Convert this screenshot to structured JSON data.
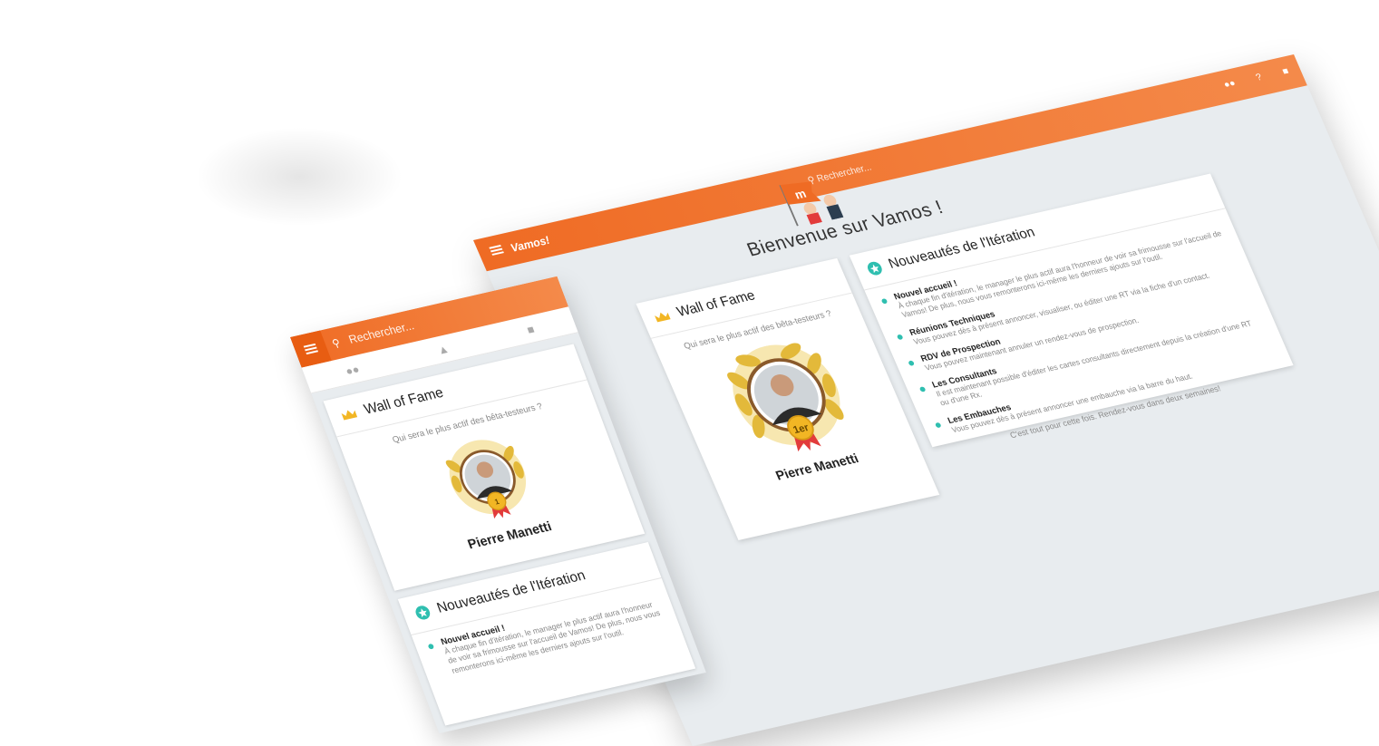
{
  "desktop": {
    "app_name": "Vamos!",
    "search_placeholder": "Rechercher...",
    "icons": [
      "group-icon",
      "help-icon",
      "chat-icon"
    ],
    "welcome_title": "Bienvenue sur Vamos !",
    "wall_of_fame": {
      "title": "Wall of Fame",
      "subtitle": "Qui sera le plus actif des bêta-testeurs ?",
      "rank": "1er",
      "winner": "Pierre Manetti"
    },
    "news": {
      "title": "Nouveautés de l'Itération",
      "items": [
        {
          "heading": "Nouvel accueil !",
          "text": "À chaque fin d'itération, le manager le plus actif aura l'honneur de voir sa frimousse sur l'accueil de Vamos! De plus, nous vous remonterons ici-même les derniers ajouts sur l'outil."
        },
        {
          "heading": "Réunions Techniques",
          "text": "Vous pouvez dès à présent annoncer, visualiser, ou éditer une RT via la fiche d'un contact."
        },
        {
          "heading": "RDV de Prospection",
          "text": "Vous pouvez maintenant annuler un rendez-vous de prospection."
        },
        {
          "heading": "Les Consultants",
          "text": "Il est maintenant possible d'éditer les cartes consultants directement depuis la création d'une RT ou d'une Rx."
        },
        {
          "heading": "Les Embauches",
          "text": "Vous pouvez dès à présent annoncer une embauche via la barre du haut."
        }
      ],
      "closing": "C'est tout pour cette fois. Rendez-vous dans deux semaines!"
    }
  },
  "mobile": {
    "search_placeholder": "Rechercher...",
    "tab_icons": [
      "group-icon",
      "graduation-icon",
      "chat-icon"
    ],
    "wall_of_fame": {
      "title": "Wall of Fame",
      "subtitle": "Qui sera le plus actif des bêta-testeurs ?",
      "rank": "1",
      "winner": "Pierre Manetti"
    },
    "news": {
      "title": "Nouveautés de l'Itération",
      "first_heading": "Nouvel accueil !",
      "first_text": "À chaque fin d'itération, le manager le plus actif aura l'honneur de voir sa frimousse sur l'accueil de Vamos! De plus, nous vous remonterons ici-même les derniers ajouts sur l'outil."
    }
  },
  "colors": {
    "accent": "#ef6b24",
    "accent_light": "#f48a4a",
    "teal": "#2fbfb0",
    "background": "#e8ecef"
  }
}
